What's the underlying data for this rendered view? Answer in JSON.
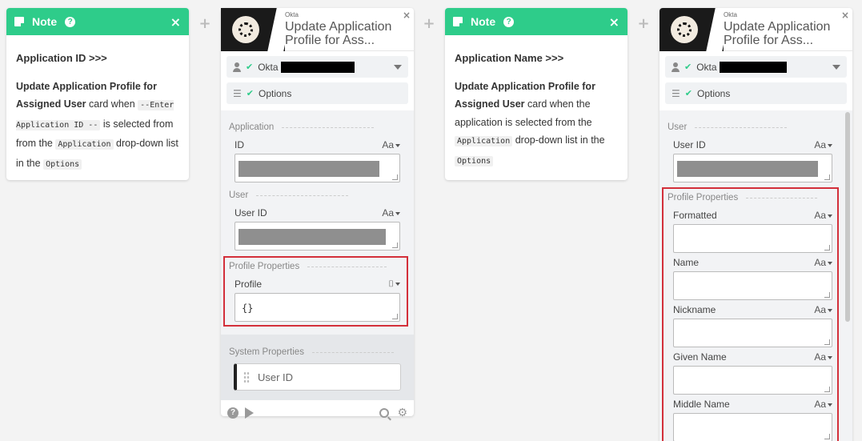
{
  "connector": "+",
  "note1": {
    "title": "Note",
    "close": "×",
    "heading": "Application ID >>>",
    "text_bold": "Update Application Profile for Assigned User",
    "text_a": " card when ",
    "code_a": "--Enter Application ID --",
    "text_b": " is selected from from the ",
    "code_b": "Application",
    "text_c": " drop-down list in the ",
    "code_c": "Options"
  },
  "card1": {
    "provider": "Okta",
    "title": "Update Application Profile for Ass...",
    "close": "×",
    "account_label": "Okta",
    "options_label": "Options",
    "section_application": "Application",
    "field_id": "ID",
    "section_user": "User",
    "field_user_id": "User ID",
    "section_profile": "Profile Properties",
    "field_profile": "Profile",
    "profile_value": "{}",
    "section_system": "System Properties",
    "system_pill": "User ID",
    "aa": "Aa"
  },
  "note2": {
    "title": "Note",
    "close": "×",
    "heading": "Application Name >>>",
    "text_bold": "Update Application Profile for Assigned User",
    "text_a": " card when the application is selected from the ",
    "code_a": "Application",
    "text_b": " drop-down list in the ",
    "code_b": "Options"
  },
  "card2": {
    "provider": "Okta",
    "title": "Update Application Profile for Ass...",
    "close": "×",
    "account_label": "Okta",
    "options_label": "Options",
    "section_user": "User",
    "field_user_id": "User ID",
    "section_profile": "Profile Properties",
    "fields": [
      "Formatted",
      "Name",
      "Nickname",
      "Given Name",
      "Middle Name"
    ],
    "aa": "Aa"
  }
}
